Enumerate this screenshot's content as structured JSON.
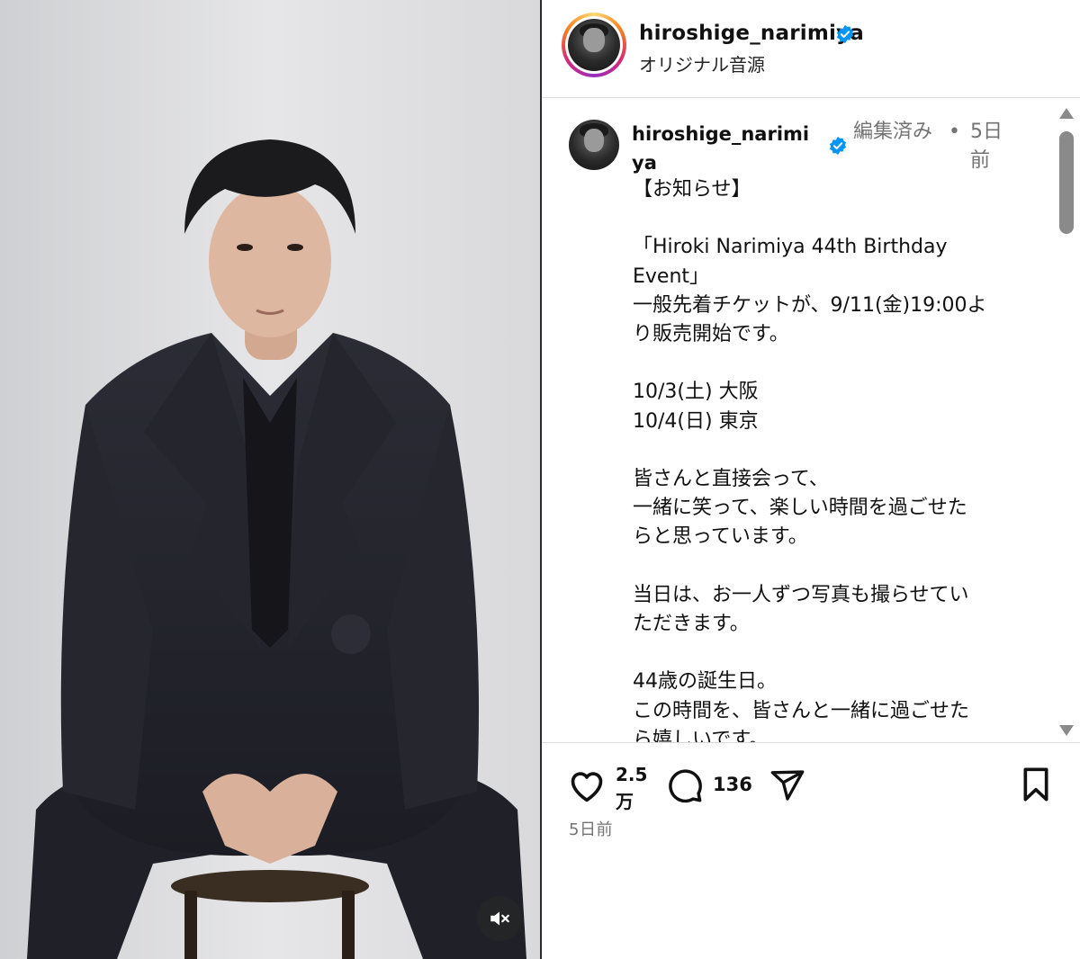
{
  "header": {
    "username": "hiroshige_narimiya",
    "audio_label": "オリジナル音源"
  },
  "caption": {
    "username": "hiroshige_narimiya",
    "edited_label": "編集済み",
    "separator": "•",
    "time_label": "5日前",
    "lines": [
      "【お知らせ】",
      "",
      "「Hiroki Narimiya 44th Birthday",
      "Event」",
      "一般先着チケットが、9/11(金)19:00よ",
      "り販売開始です。",
      "",
      "10/3(土) 大阪",
      "10/4(日) 東京",
      "",
      "皆さんと直接会って、",
      "一緒に笑って、楽しい時間を過ごせた",
      "らと思っています。",
      "",
      "当日は、お一人ずつ写真も撮らせてい",
      "ただきます。",
      "",
      "44歳の誕生日。",
      "この時間を、皆さんと一緒に過ごせた",
      "ら嬉しいです。"
    ]
  },
  "actions": {
    "like_count": "2.5万",
    "comment_count": "136",
    "post_time": "5日前"
  },
  "icons": {
    "verified": "verified-badge-icon",
    "like": "heart-icon",
    "comment": "comment-bubble-icon",
    "share": "paper-plane-icon",
    "save": "bookmark-icon",
    "mute": "speaker-muted-icon"
  },
  "colors": {
    "verified_blue": "#0095f6",
    "muted_text": "#737373",
    "divider": "#dbdbdb"
  }
}
